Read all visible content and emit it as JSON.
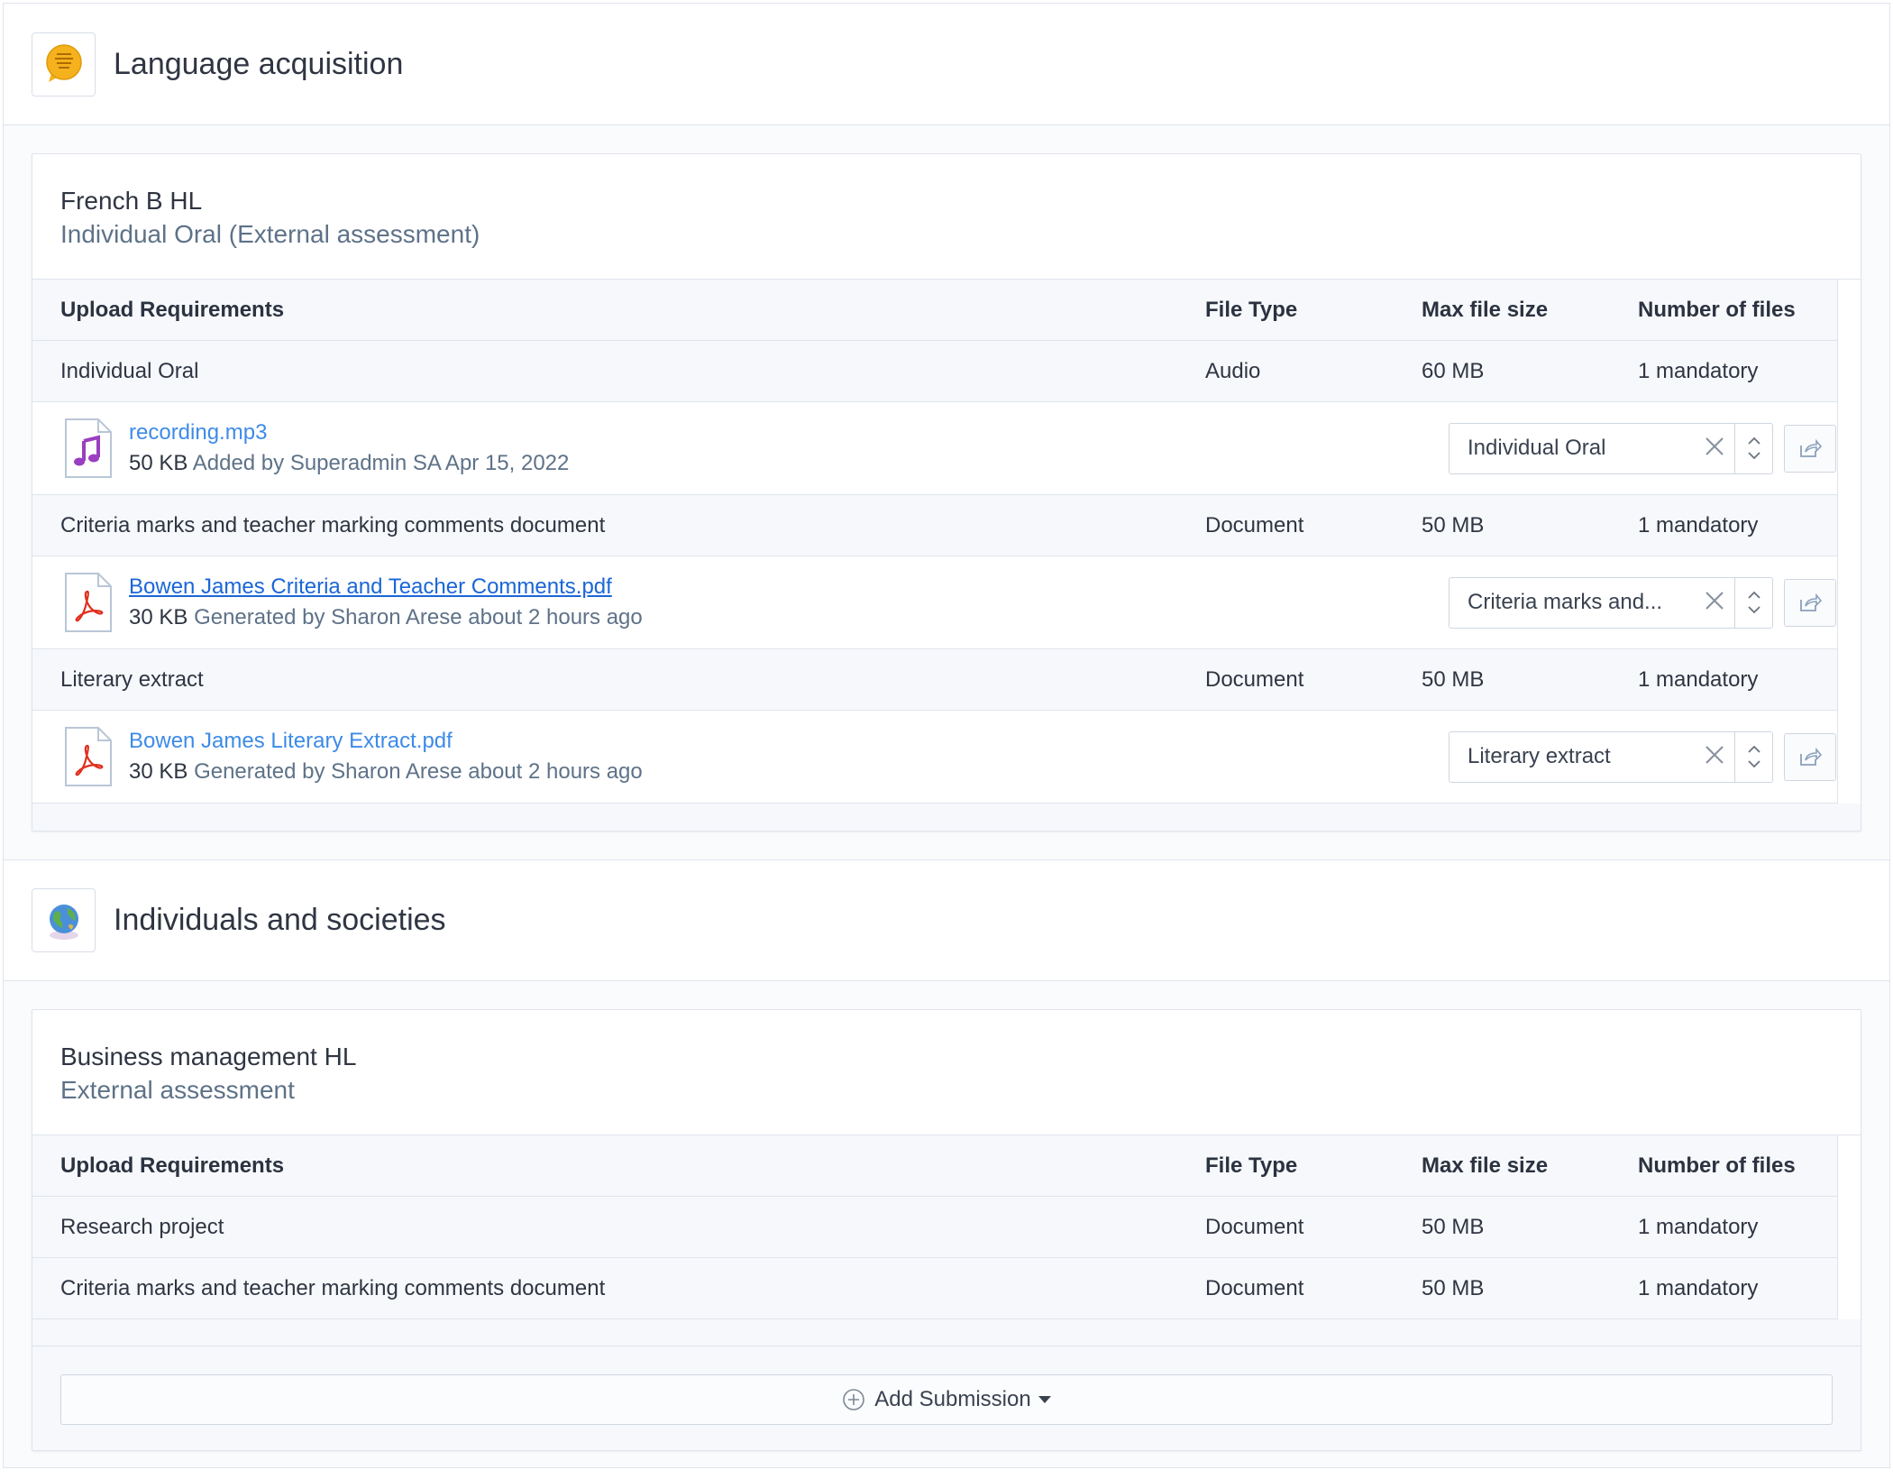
{
  "table_headers": {
    "requirement": "Upload Requirements",
    "file_type": "File Type",
    "max_size": "Max file size",
    "count": "Number of files"
  },
  "groups": [
    {
      "title": "Language acquisition",
      "icon": "speech-bubble-hello-icon",
      "course": {
        "title": "French B HL",
        "subtitle": "Individual Oral (External assessment)",
        "requirements": [
          {
            "name": "Individual Oral",
            "file_type": "Audio",
            "max_size": "60 MB",
            "count": "1 mandatory",
            "file": {
              "icon": "audio-file-icon",
              "name": "recording.mp3",
              "size": "50 KB",
              "meta": "Added by Superadmin SA Apr 15, 2022",
              "selected": "Individual Oral"
            }
          },
          {
            "name": "Criteria marks and teacher marking comments document",
            "file_type": "Document",
            "max_size": "50 MB",
            "count": "1 mandatory",
            "file": {
              "icon": "pdf-file-icon",
              "name": "Bowen James Criteria and Teacher Comments.pdf",
              "size": "30 KB",
              "meta": "Generated by Sharon Arese about 2 hours ago",
              "selected": "Criteria marks and..."
            }
          },
          {
            "name": "Literary extract",
            "file_type": "Document",
            "max_size": "50 MB",
            "count": "1 mandatory",
            "file": {
              "icon": "pdf-file-icon",
              "name": "Bowen James Literary Extract.pdf",
              "size": "30 KB",
              "meta": "Generated by Sharon Arese about 2 hours ago",
              "selected": "Literary extract"
            }
          }
        ]
      }
    },
    {
      "title": "Individuals and societies",
      "icon": "globe-icon",
      "course": {
        "title": "Business management HL",
        "subtitle": "External assessment",
        "requirements": [
          {
            "name": "Research project",
            "file_type": "Document",
            "max_size": "50 MB",
            "count": "1 mandatory"
          },
          {
            "name": "Criteria marks and teacher marking comments document",
            "file_type": "Document",
            "max_size": "50 MB",
            "count": "1 mandatory"
          }
        ]
      }
    }
  ],
  "add_submission_label": "Add Submission",
  "colors": {
    "link": "#3d8be8",
    "link_visited": "#1a66d8",
    "pdf": "#e0301e",
    "audio": "#9b3fc0",
    "border": "#dfe4ec"
  }
}
